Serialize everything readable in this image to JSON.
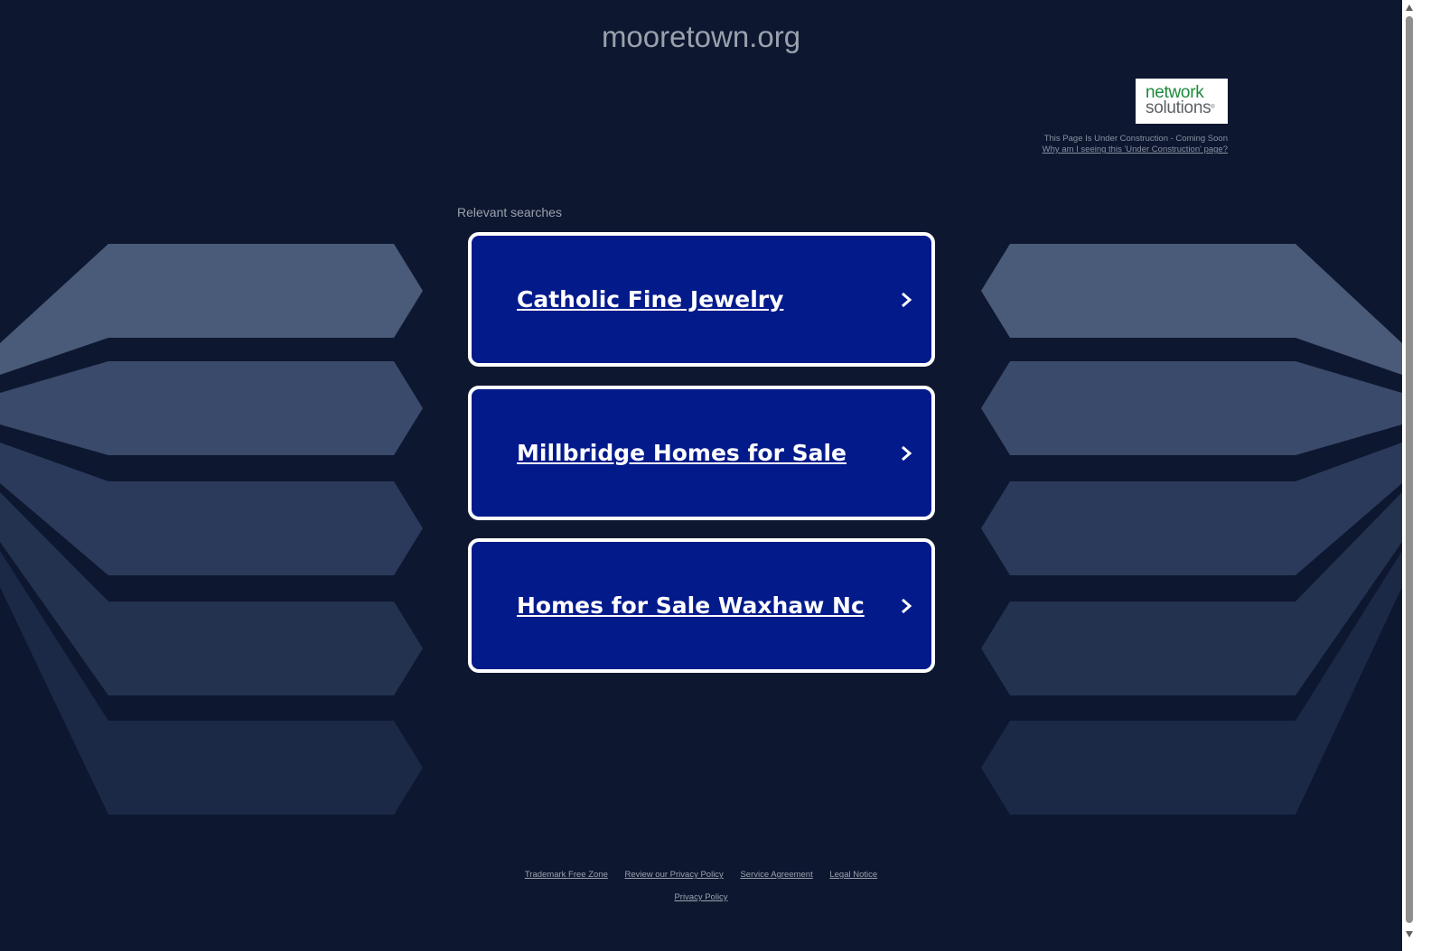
{
  "site": {
    "domain": "mooretown.org"
  },
  "branding": {
    "logo_line1": "network",
    "logo_line2": "solutions",
    "logo_reg": "®",
    "brand_color": "#1c8a3c"
  },
  "notice": {
    "status": "This Page Is Under Construction - Coming Soon",
    "why_link": "Why am I seeing this 'Under Construction' page?"
  },
  "search": {
    "heading": "Relevant searches",
    "results": [
      {
        "label": "Catholic Fine Jewelry",
        "icon": "chevron-right-icon"
      },
      {
        "label": "Millbridge Homes for Sale",
        "icon": "chevron-right-icon"
      },
      {
        "label": "Homes for Sale Waxhaw Nc",
        "icon": "chevron-right-icon"
      }
    ]
  },
  "footer": {
    "links": [
      "Trademark Free Zone",
      "Review our Privacy Policy",
      "Service Agreement",
      "Legal Notice"
    ],
    "privacy": "Privacy Policy"
  },
  "colors": {
    "background": "#0e1730",
    "result_bg": "#031a8b",
    "result_border": "#ffffff",
    "muted_text": "#9aa1ad"
  }
}
